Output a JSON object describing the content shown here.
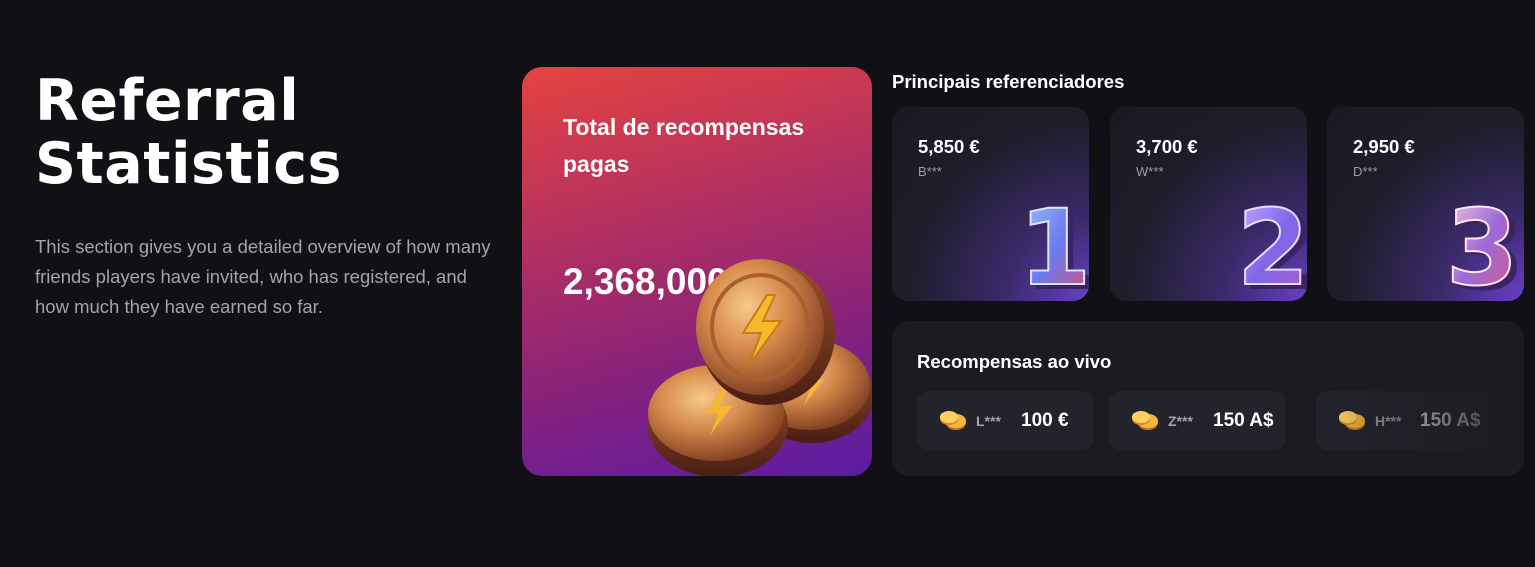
{
  "intro": {
    "title_line1": "Referral",
    "title_line2": "Statistics",
    "description": "This section gives you a detailed overview of how many friends players have invited, who has registered, and how much they have earned so far."
  },
  "total": {
    "label": "Total de recompensas pagas",
    "amount": "2,368,000 €",
    "icon": "lightning-coins-icon"
  },
  "top_referrers": {
    "title": "Principais referenciadores",
    "items": [
      {
        "amount": "5,850 €",
        "name": "B***",
        "rank": "1"
      },
      {
        "amount": "3,700 €",
        "name": "W***",
        "rank": "2"
      },
      {
        "amount": "2,950 €",
        "name": "D***",
        "rank": "3"
      }
    ]
  },
  "live_rewards": {
    "title": "Recompensas ao vivo",
    "items": [
      {
        "user": "L***",
        "value": "100 €",
        "icon": "coins-icon"
      },
      {
        "user": "Z***",
        "value": "150 A$",
        "icon": "coins-icon"
      },
      {
        "user": "H***",
        "value": "150 A$",
        "icon": "coins-icon"
      }
    ]
  },
  "colors": {
    "background": "#111115",
    "card_gradient_start": "#e5433f",
    "card_gradient_end": "#5b1ba4",
    "panel": "#1b1b22",
    "muted_text": "#a3a3ab"
  }
}
